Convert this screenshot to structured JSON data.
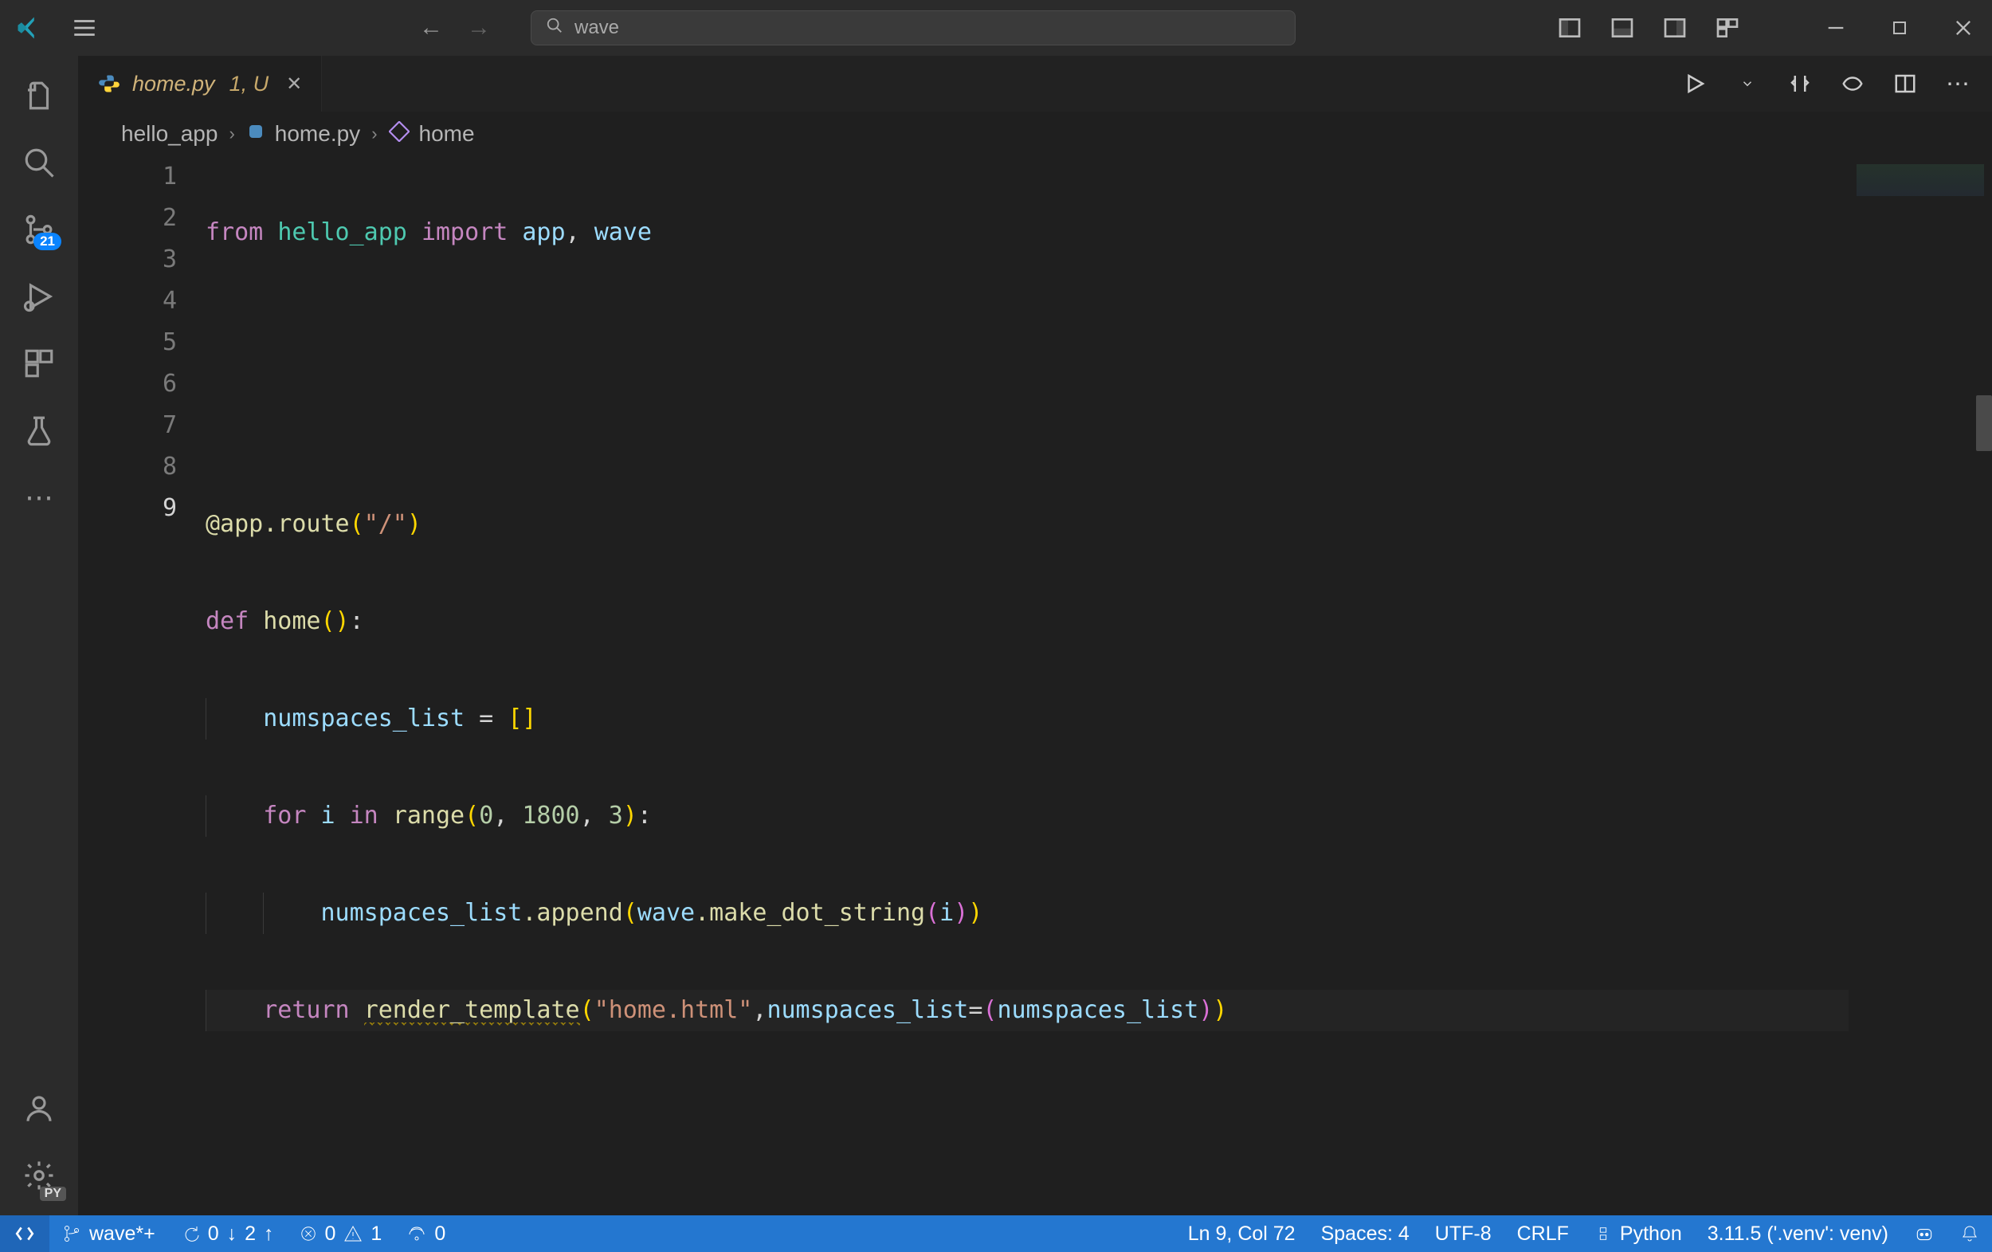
{
  "search": {
    "placeholder": "wave"
  },
  "activity": {
    "scm_badge": "21",
    "settings_ext_badge": "PY"
  },
  "tab": {
    "filename": "home.py",
    "modifiers": "1, U"
  },
  "breadcrumb": {
    "folder": "hello_app",
    "file": "home.py",
    "symbol": "home"
  },
  "code": {
    "lines": [
      "1",
      "2",
      "3",
      "4",
      "5",
      "6",
      "7",
      "8",
      "9"
    ],
    "l1": {
      "from": "from",
      "mod1": "hello_app",
      "import": "import",
      "n1": "app",
      "c": ", ",
      "n2": "wave"
    },
    "l4": {
      "dec": "@app.route",
      "str": "\"/\""
    },
    "l5": {
      "def": "def",
      "name": "home"
    },
    "l6": {
      "var": "numspaces_list",
      "eq": " = ",
      "lbr": "[",
      "rbr": "]"
    },
    "l7": {
      "for": "for",
      "i": "i",
      "in": "in",
      "range": "range",
      "a": "0",
      "b": "1800",
      "c": "3"
    },
    "l8": {
      "var": "numspaces_list",
      "m": ".append",
      "wave": "wave",
      "fn": ".make_dot_string",
      "arg": "i"
    },
    "l9": {
      "ret": "return",
      "rt": "render_template",
      "str": "\"home.html\"",
      "kw": "numspaces_list",
      "var": "numspaces_list"
    }
  },
  "status": {
    "branch": "wave*+",
    "sync_down": "0",
    "sync_up": "2",
    "errors": "0",
    "warnings": "1",
    "ports": "0",
    "cursor": "Ln 9, Col 72",
    "indent": "Spaces: 4",
    "encoding": "UTF-8",
    "eol": "CRLF",
    "lang": "Python",
    "interp": "3.11.5 ('.venv': venv)"
  }
}
